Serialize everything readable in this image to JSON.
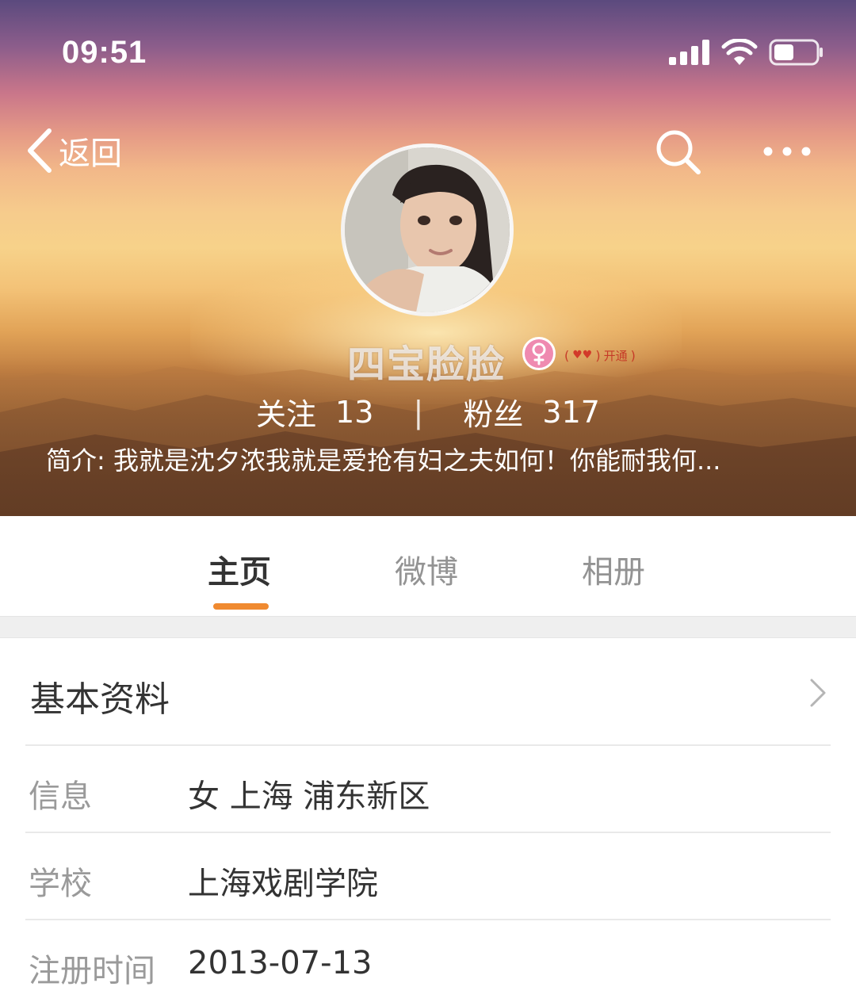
{
  "status_bar": {
    "time": "09:51"
  },
  "nav": {
    "back_label": "返回"
  },
  "profile": {
    "name": "四宝脸脸",
    "vip_label": "开通",
    "follow_label": "关注",
    "follow_count": "13",
    "separator": "|",
    "fans_label": "粉丝",
    "fans_count": "317",
    "bio": "简介: 我就是沈夕浓我就是爱抢有妇之夫如何！你能耐我何..."
  },
  "tabs": [
    {
      "label": "主页",
      "active": true
    },
    {
      "label": "微博",
      "active": false
    },
    {
      "label": "相册",
      "active": false
    }
  ],
  "basic_info": {
    "title": "基本资料",
    "rows": [
      {
        "label": "信息",
        "value": "女  上海 浦东新区"
      },
      {
        "label": "学校",
        "value": "上海戏剧学院"
      },
      {
        "label": "注册时间",
        "value": "2013-07-13"
      }
    ]
  },
  "colors": {
    "accent": "#f08a30",
    "active_tab": "#333333",
    "inactive_tab": "#939393",
    "gender_badge": "#ef8ab0"
  },
  "icons": {
    "back": "chevron-left-icon",
    "search": "search-icon",
    "more": "more-dots-icon",
    "gender": "female-icon",
    "chevron": "chevron-right-icon",
    "signal": "signal-icon",
    "wifi": "wifi-icon",
    "battery": "battery-icon"
  }
}
